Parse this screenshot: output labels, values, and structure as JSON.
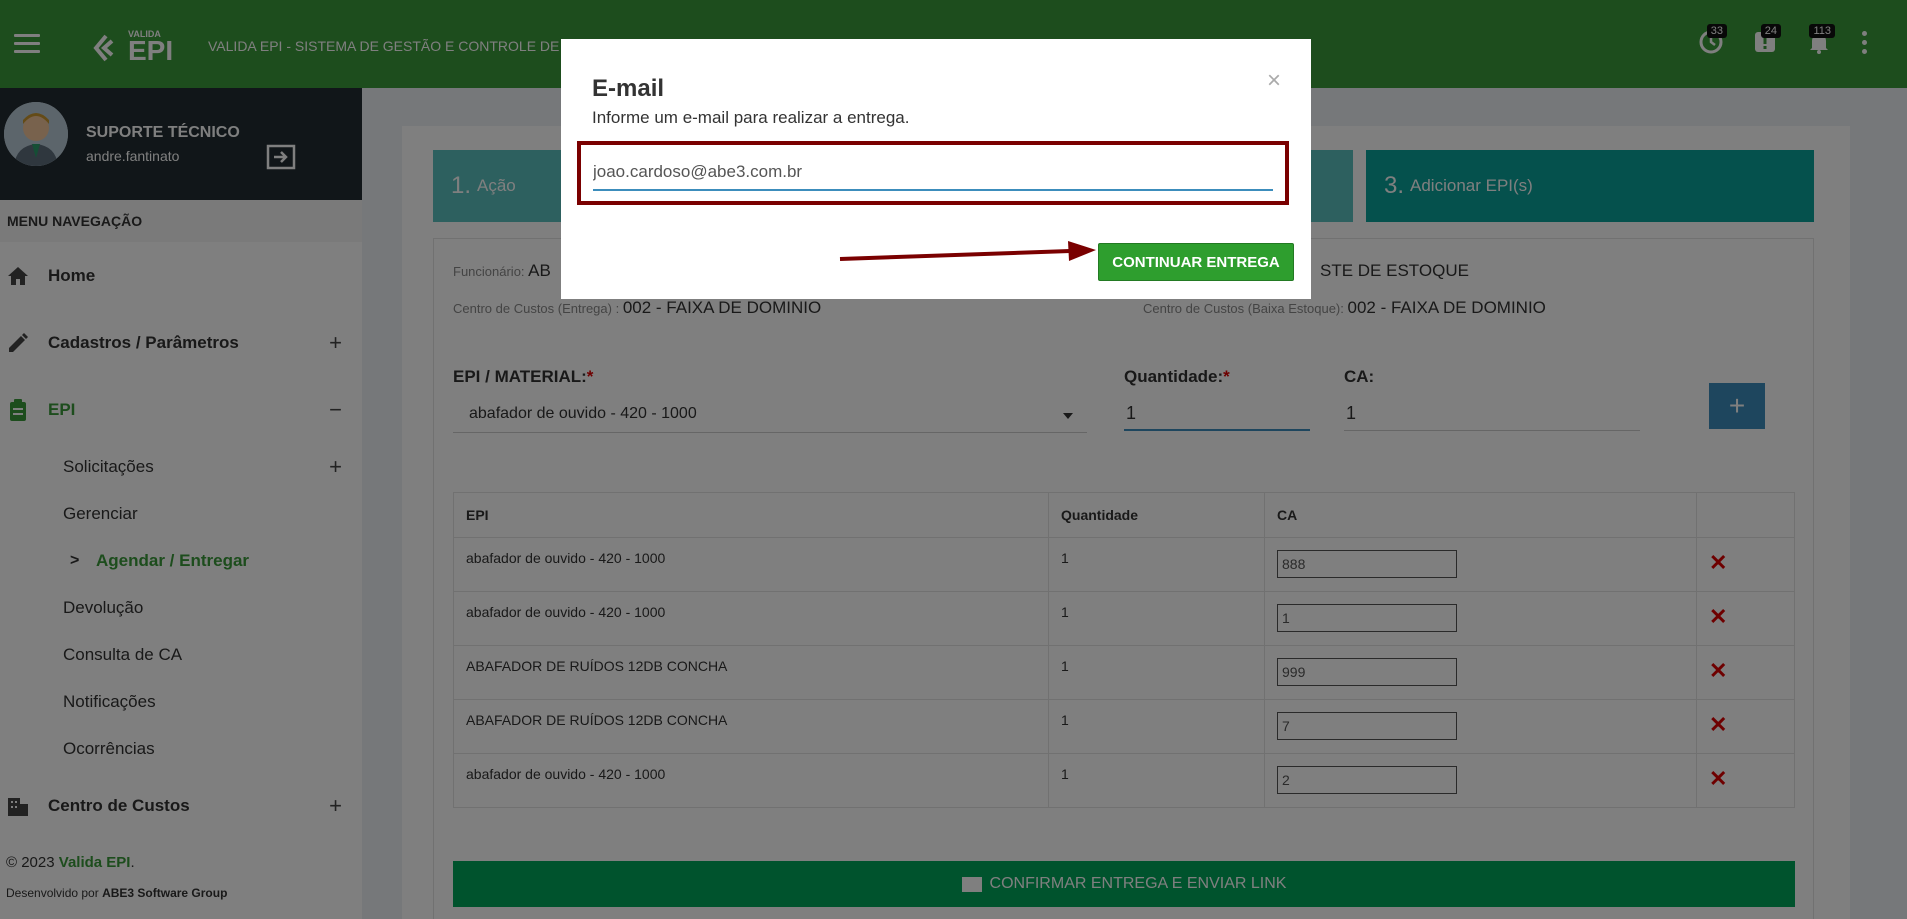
{
  "topbar": {
    "logo_small": "VALIDA",
    "logo_big": "EPI",
    "title": "VALIDA EPI - SISTEMA DE GESTÃO E CONTROLE DE",
    "badges": [
      "33",
      "24",
      "113"
    ]
  },
  "user": {
    "name": "SUPORTE TÉCNICO",
    "login": "andre.fantinato"
  },
  "sidebar": {
    "header": "MENU NAVEGAÇÃO",
    "home": "Home",
    "cadastros": "Cadastros / Parâmetros",
    "epi": "EPI",
    "sub": {
      "solicitacoes": "Solicitações",
      "gerenciar": "Gerenciar",
      "agendar": "Agendar / Entregar",
      "devolucao": "Devolução",
      "consulta": "Consulta de CA",
      "notificacoes": "Notificações",
      "ocorrencias": "Ocorrências"
    },
    "centro": "Centro de Custos",
    "footer_year": "© 2023",
    "footer_brand": "Valida EPI",
    "footer_dot": ".",
    "footer_dev_prefix": "Desenvolvido por",
    "footer_dev_name": "ABE3 Software Group"
  },
  "steps": {
    "step1_num": "1.",
    "step1_label": "Ação",
    "step3_num": "3.",
    "step3_label": "Adicionar EPI(s)"
  },
  "info": {
    "funcionario_label": "Funcionário:",
    "funcionario_value": "AB",
    "estoque_value": "STE DE ESTOQUE",
    "cc_entrega_label": "Centro de Custos (Entrega) :",
    "cc_entrega_value": "002 - FAIXA DE DOMINIO",
    "cc_baixa_label": "Centro de Custos (Baixa Estoque):",
    "cc_baixa_value": "002 - FAIXA DE DOMINIO"
  },
  "form": {
    "epi_label": "EPI / MATERIAL:",
    "epi_value": "abafador de ouvido - 420 - 1000",
    "qty_label": "Quantidade:",
    "qty_value": "1",
    "ca_label": "CA:",
    "ca_value": "1",
    "required_mark": "*",
    "add_symbol": "+"
  },
  "table": {
    "headers": [
      "EPI",
      "Quantidade",
      "CA",
      ""
    ],
    "rows": [
      {
        "epi": "abafador de ouvido - 420 - 1000",
        "qty": "1",
        "ca": "888"
      },
      {
        "epi": "abafador de ouvido - 420 - 1000",
        "qty": "1",
        "ca": "1"
      },
      {
        "epi": "ABAFADOR DE RUÍDOS 12DB CONCHA",
        "qty": "1",
        "ca": "999"
      },
      {
        "epi": "ABAFADOR DE RUÍDOS 12DB CONCHA",
        "qty": "1",
        "ca": "7"
      },
      {
        "epi": "abafador de ouvido - 420 - 1000",
        "qty": "1",
        "ca": "2"
      }
    ],
    "delete_symbol": "✕"
  },
  "confirm_button": "CONFIRMAR ENTREGA E ENVIAR LINK",
  "modal": {
    "title": "E-mail",
    "subtitle": "Informe um e-mail para realizar a entrega.",
    "close": "×",
    "email_value": "joao.cardoso@abe3.com.br",
    "continue_label": "CONTINUAR ENTREGA"
  },
  "colors": {
    "topbar": "#3a9a3a",
    "highlight_border": "#7a0000",
    "continue_button": "#2e9e2e",
    "confirm_button": "#00a65a"
  }
}
